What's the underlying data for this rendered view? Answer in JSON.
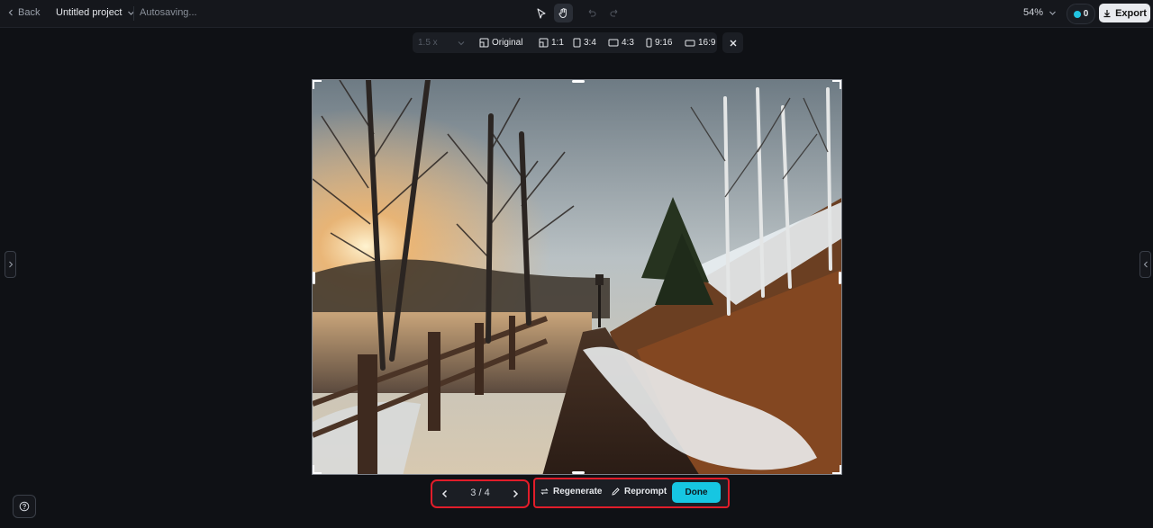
{
  "header": {
    "back_label": "Back",
    "project_name": "Untitled project",
    "status": "Autosaving...",
    "zoom": "54%",
    "credits": "0",
    "export_label": "Export"
  },
  "ratio_bar": {
    "scale": "1.5 x",
    "options": [
      "Original",
      "1:1",
      "3:4",
      "4:3",
      "9:16",
      "16:9"
    ]
  },
  "pager": {
    "current": "3 / 4"
  },
  "actions": {
    "regenerate": "Regenerate",
    "reprompt": "Reprompt",
    "done": "Done"
  },
  "colors": {
    "accent": "#16c6e2",
    "highlight": "#e11d2a",
    "background": "#0f1115"
  }
}
